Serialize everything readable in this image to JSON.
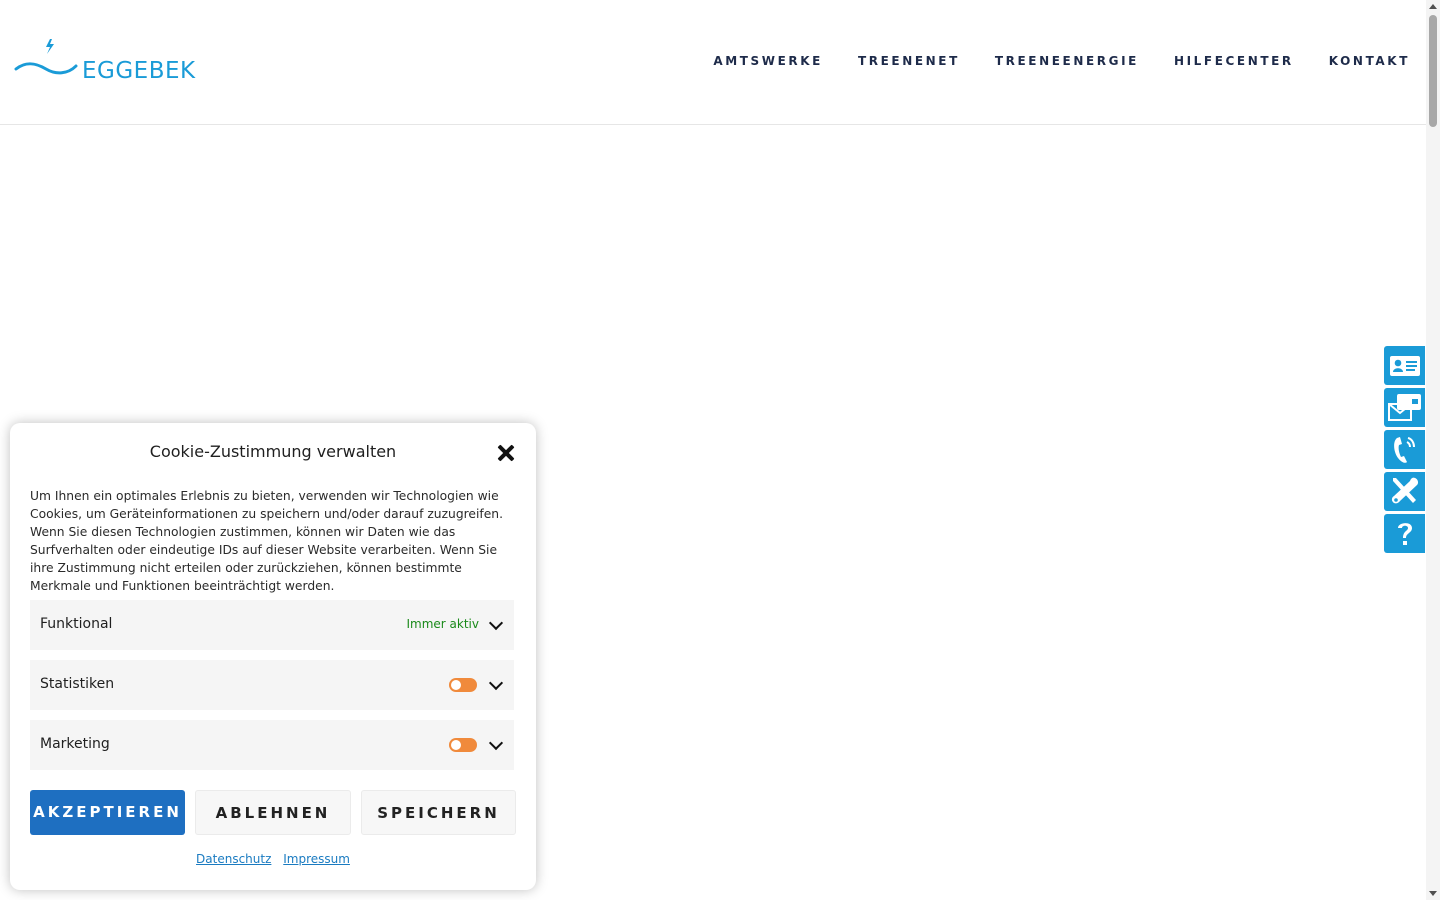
{
  "header": {
    "logo_text": "EGGEBEK",
    "nav": [
      "AMTSWERKE",
      "TREENENET",
      "TREENEENERGIE",
      "HILFECENTER",
      "KONTAKT"
    ]
  },
  "side_buttons": [
    "contact-card-icon",
    "mail-phone-icon",
    "phone-icon",
    "tools-icon",
    "help-icon"
  ],
  "cookie": {
    "title": "Cookie-Zustimmung verwalten",
    "message": "Um Ihnen ein optimales Erlebnis zu bieten, verwenden wir Technologien wie Cookies, um Geräteinformationen zu speichern und/oder darauf zuzugreifen. Wenn Sie diesen Technologien zustimmen, können wir Daten wie das Surfverhalten oder eindeutige IDs auf dieser Website verarbeiten. Wenn Sie ihre Zustimmung nicht erteilen oder zurückziehen, können bestimmte Merkmale und Funktionen beeinträchtigt werden.",
    "categories": [
      {
        "label": "Funktional",
        "status": "Immer aktiv"
      },
      {
        "label": "Statistiken"
      },
      {
        "label": "Marketing"
      }
    ],
    "buttons": {
      "accept": "AKZEPTIEREN",
      "deny": "ABLEHNEN",
      "save": "SPEICHERN"
    },
    "links": {
      "privacy": "Datenschutz",
      "imprint": "Impressum"
    }
  },
  "colors": {
    "brand": "#1a9bd7",
    "accept": "#1e6fc1",
    "toggle": "#f08a3c",
    "active": "#1a8a1a"
  }
}
